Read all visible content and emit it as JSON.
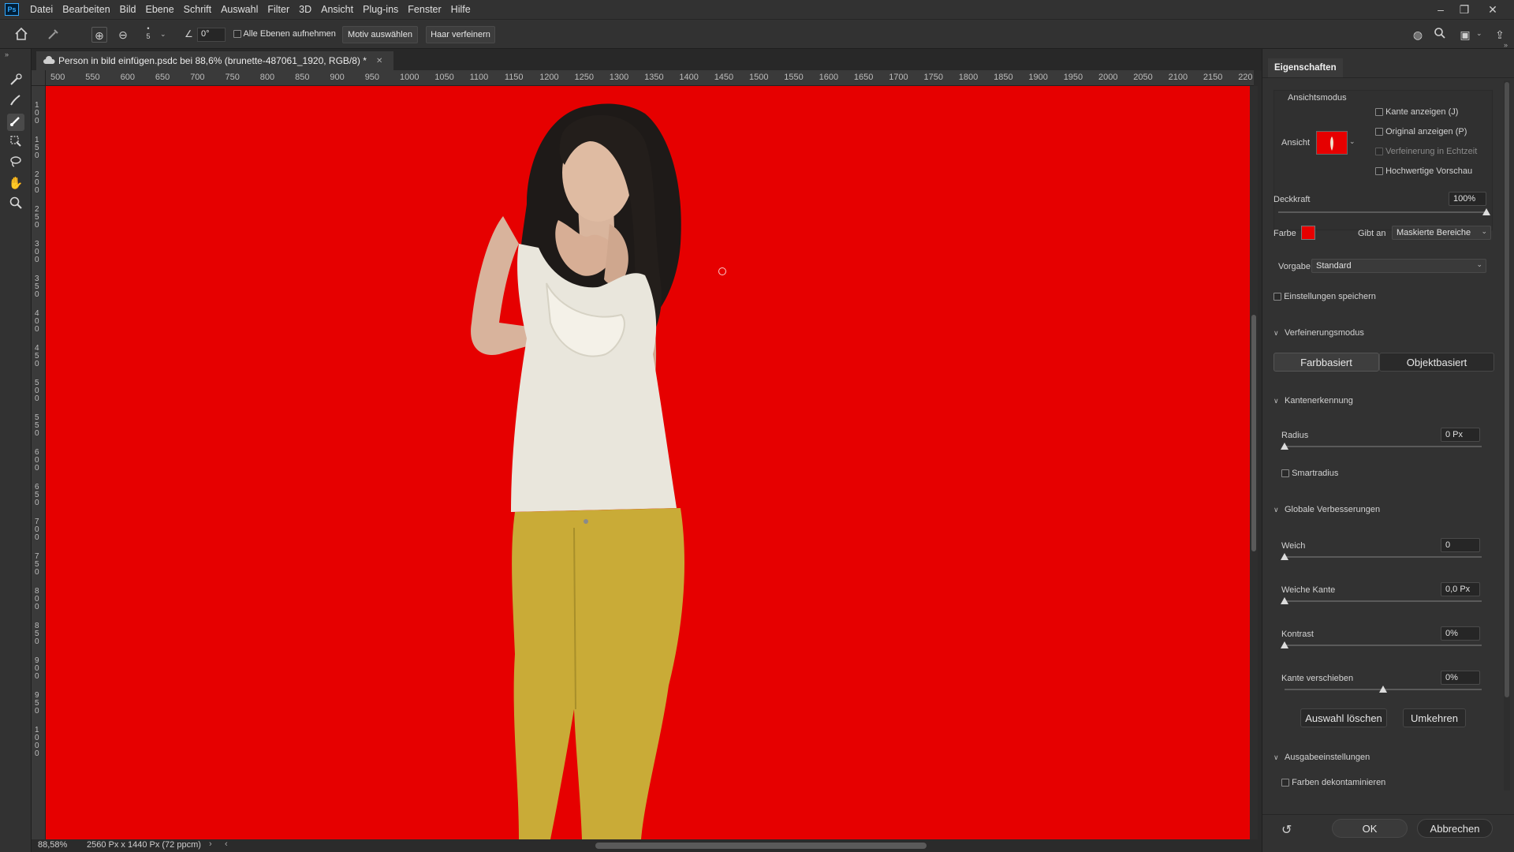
{
  "app": {
    "logo": "Ps"
  },
  "menu": [
    "Datei",
    "Bearbeiten",
    "Bild",
    "Ebene",
    "Schrift",
    "Auswahl",
    "Filter",
    "3D",
    "Ansicht",
    "Plug-ins",
    "Fenster",
    "Hilfe"
  ],
  "options": {
    "brush_size": "5",
    "angle_value": "0°",
    "sample_all_label": "Alle Ebenen aufnehmen",
    "select_subject_label": "Motiv auswählen",
    "refine_hair_label": "Haar verfeinern"
  },
  "document": {
    "tab_title": "Person in bild einfügen.psdc bei 88,6% (brunette-487061_1920, RGB/8) *",
    "zoom": "88,58%",
    "dimensions": "2560 Px x 1440 Px (72 ppcm)"
  },
  "ruler_top": [
    "500",
    "550",
    "600",
    "650",
    "700",
    "750",
    "800",
    "850",
    "900",
    "950",
    "1000",
    "1050",
    "1100",
    "1150",
    "1200",
    "1250",
    "1300",
    "1350",
    "1400",
    "1450",
    "1500",
    "1550",
    "1600",
    "1650",
    "1700",
    "1750",
    "1800",
    "1850",
    "1900",
    "1950",
    "2000",
    "2050",
    "2100",
    "2150",
    "220"
  ],
  "ruler_left": [
    "100",
    "150",
    "200",
    "250",
    "300",
    "350",
    "400",
    "450",
    "500",
    "550",
    "600",
    "650",
    "700",
    "750",
    "800",
    "850",
    "900",
    "950",
    "1000"
  ],
  "panel": {
    "tab": "Eigenschaften",
    "view_mode_title": "Ansichtsmodus",
    "view_label": "Ansicht",
    "show_edge": "Kante anzeigen (J)",
    "show_original": "Original anzeigen (P)",
    "realtime_refine": "Verfeinerung in Echtzeit",
    "hq_preview": "Hochwertige Vorschau",
    "opacity_label": "Deckkraft",
    "opacity_value": "100%",
    "opacity_level": 1.0,
    "color_label": "Farbe",
    "color_value": "#e60000",
    "indicates_label": "Gibt an",
    "indicates_value": "Maskierte Bereiche",
    "preset_label": "Vorgabe",
    "preset_value": "Standard",
    "save_settings": "Einstellungen speichern",
    "refine_mode_title": "Verfeinerungsmodus",
    "color_based": "Farbbasiert",
    "object_based": "Objektbasiert",
    "edge_detection_title": "Kantenerkennung",
    "radius_label": "Radius",
    "radius_value": "0 Px",
    "smart_radius": "Smartradius",
    "global_title": "Globale Verbesserungen",
    "smooth_label": "Weich",
    "smooth_value": "0",
    "feather_label": "Weiche Kante",
    "feather_value": "0,0 Px",
    "contrast_label": "Kontrast",
    "contrast_value": "0%",
    "shift_edge_label": "Kante verschieben",
    "shift_edge_value": "0%",
    "shift_edge_level": 0.5,
    "clear_selection": "Auswahl löschen",
    "invert": "Umkehren",
    "output_title": "Ausgabeeinstellungen",
    "decontaminate": "Farben dekontaminieren",
    "ok": "OK",
    "cancel": "Abbrechen"
  }
}
